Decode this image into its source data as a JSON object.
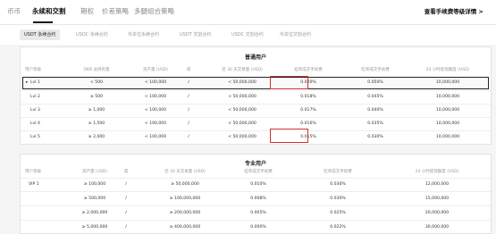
{
  "top_tabs": [
    "币币",
    "永续和交割",
    "期权",
    "价差策略",
    "多腿组合策略"
  ],
  "fee_link": "查看手续费等级详情 >",
  "sub_tabs": [
    "USDT 永续合约",
    "USDC 永续合约",
    "币本位永续合约",
    "USDT 交割合约",
    "USDC 交割合约",
    "币本位交割合约"
  ],
  "regular": {
    "title": "普通用户",
    "headers": [
      "用户等级",
      "OKB 总持有量",
      "资产量 (USD)",
      "或",
      "近 30 天交易量 (USD)",
      "挂单成交手续费",
      "吃单成交手续费",
      "24 小时提现额度 (USD)"
    ],
    "rows": [
      [
        "Lvl 1",
        "< 500",
        "< 100,000",
        "/",
        "< 50,000,000",
        "0.020%",
        "0.050%",
        "10,000,000"
      ],
      [
        "Lvl 2",
        "≥ 500",
        "< 100,000",
        "/",
        "< 50,000,000",
        "0.018%",
        "0.045%",
        "10,000,000"
      ],
      [
        "Lvl 3",
        "≥ 1,000",
        "< 100,000",
        "/",
        "< 50,000,000",
        "0.017%",
        "0.040%",
        "10,000,000"
      ],
      [
        "Lvl 4",
        "≥ 1,500",
        "< 100,000",
        "/",
        "< 50,000,000",
        "0.016%",
        "0.035%",
        "10,000,000"
      ],
      [
        "Lvl 5",
        "≥ 2,000",
        "< 100,000",
        "/",
        "< 50,000,000",
        "0.015%",
        "0.030%",
        "10,000,000"
      ]
    ]
  },
  "pro": {
    "title": "专业用户",
    "headers": [
      "用户等级",
      "资产量 (USD)",
      "或",
      "近 30 天交易量 (USD)",
      "挂单成交手续费",
      "吃单成交手续费",
      "24 小时提现额度 (USD)"
    ],
    "rows": [
      [
        "VIP 1",
        "≥ 100,000",
        "/",
        "≥ 50,000,000",
        "0.010%",
        "0.030%",
        "12,000,000"
      ],
      [
        "",
        "≥ 500,000",
        "/",
        "≥ 100,000,000",
        "0.008%",
        "0.030%",
        "15,000,000"
      ],
      [
        "",
        "≥ 2,000,000",
        "/",
        "≥ 200,000,000",
        "0.005%",
        "0.025%",
        "20,000,000"
      ],
      [
        "",
        "≥ 5,000,000",
        "/",
        "≥ 400,000,000",
        "0.000%",
        "0.022%",
        "30,000,000"
      ]
    ]
  }
}
